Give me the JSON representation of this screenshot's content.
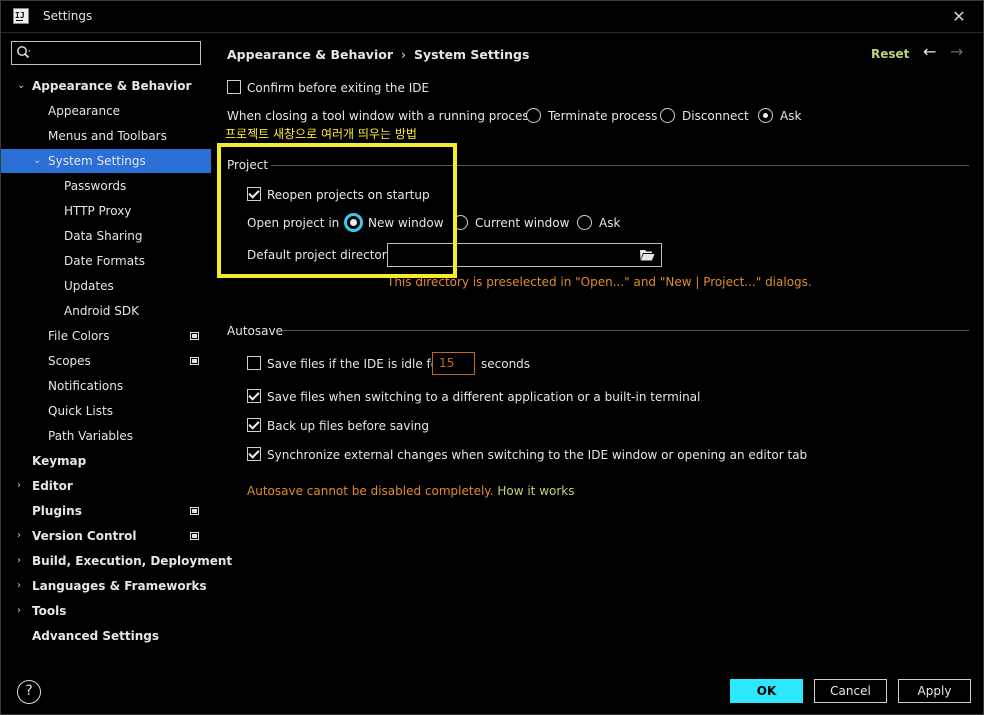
{
  "window": {
    "title": "Settings",
    "logo_text": "IJ"
  },
  "sidebar": {
    "search": {
      "placeholder": ""
    },
    "items": [
      {
        "label": "Appearance & Behavior",
        "expanded": true
      },
      {
        "label": "Appearance"
      },
      {
        "label": "Menus and Toolbars"
      },
      {
        "label": "System Settings",
        "expanded": true,
        "selected": true
      },
      {
        "label": "Passwords"
      },
      {
        "label": "HTTP Proxy"
      },
      {
        "label": "Data Sharing"
      },
      {
        "label": "Date Formats"
      },
      {
        "label": "Updates"
      },
      {
        "label": "Android SDK"
      },
      {
        "label": "File Colors"
      },
      {
        "label": "Scopes"
      },
      {
        "label": "Notifications"
      },
      {
        "label": "Quick Lists"
      },
      {
        "label": "Path Variables"
      },
      {
        "label": "Keymap"
      },
      {
        "label": "Editor"
      },
      {
        "label": "Plugins"
      },
      {
        "label": "Version Control"
      },
      {
        "label": "Build, Execution, Deployment"
      },
      {
        "label": "Languages & Frameworks"
      },
      {
        "label": "Tools"
      },
      {
        "label": "Advanced Settings"
      }
    ]
  },
  "header": {
    "breadcrumb_parent": "Appearance & Behavior",
    "breadcrumb_sep": "›",
    "breadcrumb_current": "System Settings",
    "reset_label": "Reset"
  },
  "general": {
    "confirm_exit_label": "Confirm before exiting the IDE",
    "confirm_exit_checked": false,
    "closing_label": "When closing a tool window with a running process:",
    "closing_options": [
      "Terminate process",
      "Disconnect",
      "Ask"
    ],
    "closing_selected": "Ask"
  },
  "annotation": {
    "korean_note": "프로젝트 새창으로 여러개 띄우는 방법"
  },
  "project": {
    "section_title": "Project",
    "reopen_label": "Reopen projects on startup",
    "reopen_checked": true,
    "open_in_label": "Open project in",
    "open_in_options": [
      "New window",
      "Current window",
      "Ask"
    ],
    "open_in_selected": "New window",
    "default_dir_label": "Default project directory:",
    "default_dir_value": "",
    "dir_hint": "This directory is preselected in \"Open...\" and \"New | Project...\" dialogs."
  },
  "autosave": {
    "section_title": "Autosave",
    "idle_label": "Save files if the IDE is idle for",
    "idle_checked": false,
    "idle_seconds": "15",
    "idle_unit": "seconds",
    "switch_label": "Save files when switching to a different application or a built-in terminal",
    "switch_checked": true,
    "backup_label": "Back up files before saving",
    "backup_checked": true,
    "sync_label": "Synchronize external changes when switching to the IDE window or opening an editor tab",
    "sync_checked": true,
    "warning_text": "Autosave cannot be disabled completely.",
    "how_link": "How it works"
  },
  "footer": {
    "help_label": "?",
    "ok_label": "OK",
    "cancel_label": "Cancel",
    "apply_label": "Apply"
  },
  "colors": {
    "background": "#000000",
    "selection": "#2a6fd6",
    "ok_button": "#2ce8ff",
    "link_green": "#b9d67a",
    "warning_orange": "#e08a30",
    "highlight_yellow": "#f5ec2a"
  }
}
